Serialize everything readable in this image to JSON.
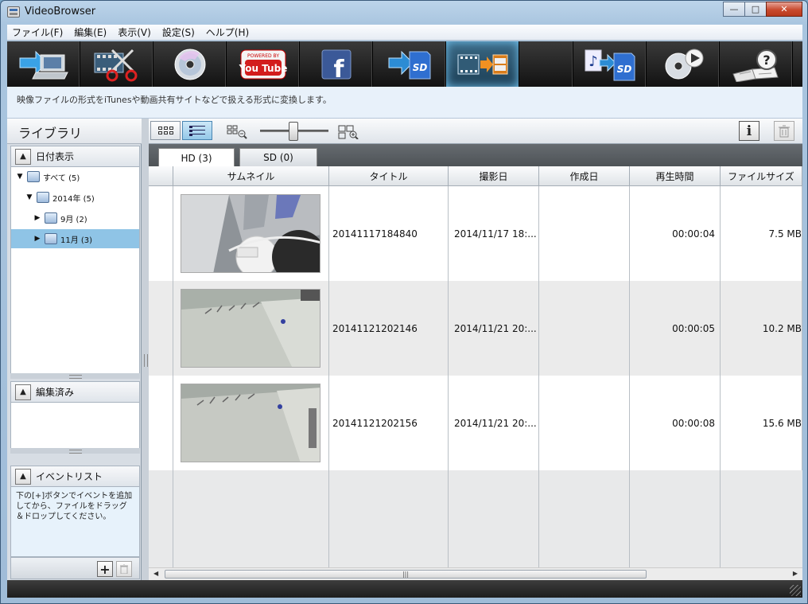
{
  "window": {
    "title": "VideoBrowser"
  },
  "menu": [
    "ファイル(F)",
    "編集(E)",
    "表示(V)",
    "設定(S)",
    "ヘルプ(H)"
  ],
  "toolbar": {
    "buttons": [
      {
        "name": "import-to-pc",
        "icon": "arrow-to-laptop-icon"
      },
      {
        "name": "edit",
        "icon": "film-scissors-icon"
      },
      {
        "name": "disc-create",
        "icon": "disc-icon"
      },
      {
        "name": "youtube-upload",
        "icon": "youtube-icon",
        "text": "You Tube",
        "badge": "POWERED BY"
      },
      {
        "name": "facebook-upload",
        "icon": "facebook-icon",
        "text": "f"
      },
      {
        "name": "copy-to-sd",
        "icon": "arrow-to-sd-icon",
        "text": "SD"
      },
      {
        "name": "convert-format",
        "icon": "film-convert-icon",
        "active": true
      },
      {
        "name": "music-to-sd",
        "icon": "music-to-sd-icon",
        "text": "SD"
      },
      {
        "name": "disc-play",
        "icon": "disc-play-icon"
      },
      {
        "name": "help",
        "icon": "help-book-icon",
        "text": "?"
      }
    ]
  },
  "info": {
    "description": "映像ファイルの形式をiTunesや動画共有サイトなどで扱える形式に変換します。"
  },
  "library": {
    "title": "ライブラリ",
    "date_view": {
      "label": "日付表示",
      "tree": [
        {
          "label": "すべて (5)",
          "level": 0,
          "expanded": true
        },
        {
          "label": "2014年 (5)",
          "level": 1,
          "expanded": true
        },
        {
          "label": "9月 (2)",
          "level": 2,
          "expanded": false
        },
        {
          "label": "11月 (3)",
          "level": 2,
          "expanded": false,
          "selected": true
        }
      ]
    },
    "edited": {
      "label": "編集済み"
    },
    "event_list": {
      "label": "イベントリスト",
      "hint": "下の[+]ボタンでイベントを追加してから、ファイルをドラッグ＆ドロップしてください。",
      "add_symbol": "+"
    }
  },
  "view": {
    "tabs": [
      {
        "label": "HD (3)",
        "active": true
      },
      {
        "label": "SD (0)",
        "active": false
      }
    ],
    "info_symbol": "i"
  },
  "table": {
    "columns": [
      "サムネイル",
      "タイトル",
      "撮影日",
      "作成日",
      "再生時間",
      "ファイルサイズ"
    ],
    "rows": [
      {
        "title": "20141117184840",
        "shot_date": "2014/11/17 18:...",
        "created": "",
        "duration": "00:00:04",
        "size": "7.5 MB"
      },
      {
        "title": "20141121202146",
        "shot_date": "2014/11/21 20:...",
        "created": "",
        "duration": "00:00:05",
        "size": "10.2 MB"
      },
      {
        "title": "20141121202156",
        "shot_date": "2014/11/21 20:...",
        "created": "",
        "duration": "00:00:08",
        "size": "15.6 MB"
      }
    ]
  },
  "colors": {
    "accent": "#8fc4e6",
    "toolbar_bg": "#1a1a1a",
    "active_tool": "#2a5a78"
  }
}
